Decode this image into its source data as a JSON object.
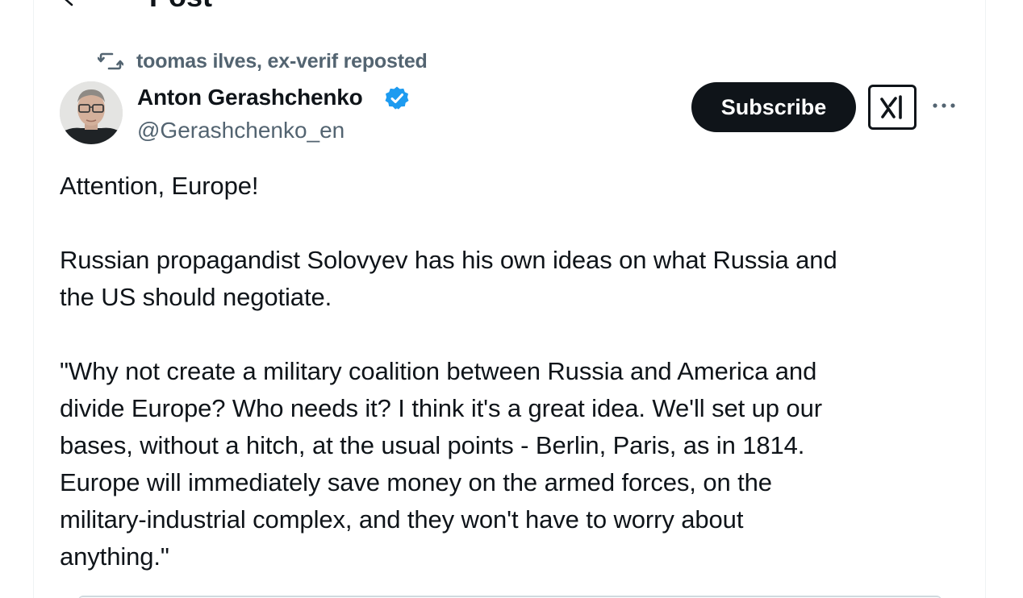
{
  "header": {
    "title": "Post"
  },
  "repost": {
    "text": "toomas ilves, ex-verif reposted"
  },
  "author": {
    "name": "Anton Gerashchenko",
    "handle": "@Gerashchenko_en",
    "verified": true
  },
  "actions": {
    "subscribe_label": "Subscribe",
    "grok_icon": "grok-icon",
    "more_icon": "more-icon"
  },
  "tweet": {
    "paragraphs": [
      "Attention, Europe!",
      "Russian propagandist Solovyev has his own ideas on what Russia and\nthe US should negotiate.",
      "\"Why not create a military coalition between Russia and America and\ndivide Europe? Who needs it? I think it's a great idea. We'll set up our\nbases, without a hitch, at the usual points - Berlin, Paris, as in 1814.\nEurope will immediately save money on the armed forces, on the\nmilitary-industrial complex, and they won't have to worry about\nanything.\""
    ]
  },
  "colors": {
    "text": "#0f1419",
    "secondary": "#536471",
    "verified": "#1d9bf0",
    "button_bg": "#0f1419",
    "border": "#eff3f4"
  }
}
